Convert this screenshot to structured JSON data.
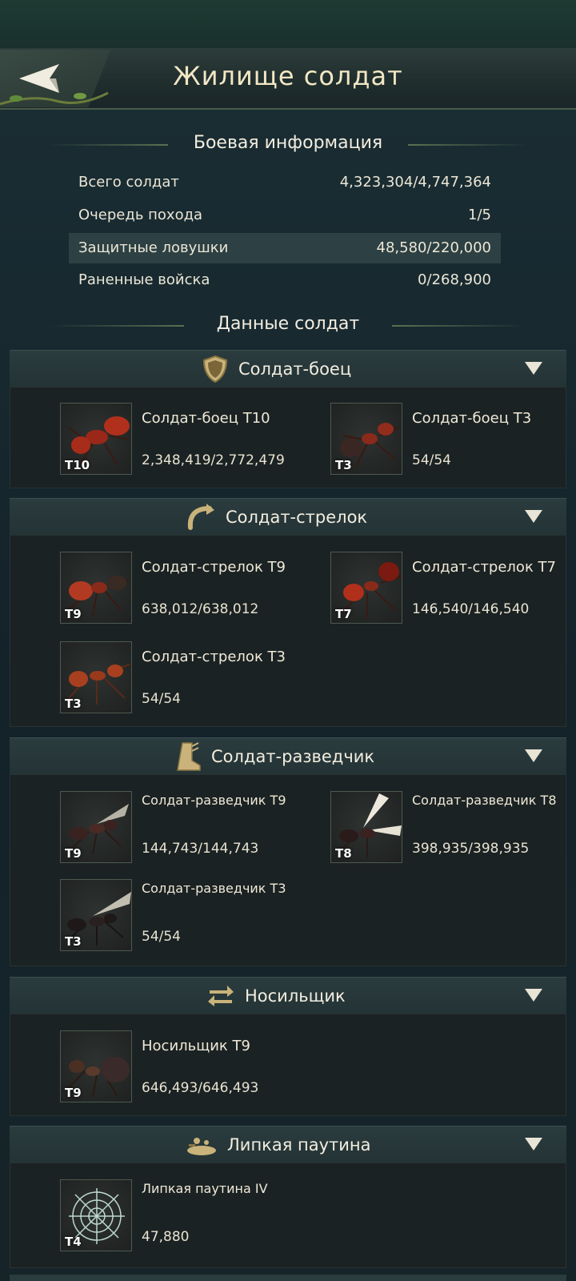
{
  "header": {
    "title": "Жилище солдат"
  },
  "battle_info": {
    "title": "Боевая информация",
    "rows": [
      {
        "label": "Всего солдат",
        "value": "4,323,304/4,747,364"
      },
      {
        "label": "Очередь похода",
        "value": "1/5"
      },
      {
        "label": "Защитные ловушки",
        "value": "48,580/220,000"
      },
      {
        "label": "Раненные войска",
        "value": "0/268,900"
      }
    ]
  },
  "soldier_data": {
    "title": "Данные солдат"
  },
  "categories": [
    {
      "title": "Солдат-боец",
      "icon": "shield-icon",
      "units": [
        {
          "name": "Солдат-боец T10",
          "count": "2,348,419/2,772,479",
          "tier": "T10"
        },
        {
          "name": "Солдат-боец T3",
          "count": "54/54",
          "tier": "T3"
        }
      ]
    },
    {
      "title": "Солдат-стрелок",
      "icon": "bow-icon",
      "units": [
        {
          "name": "Солдат-стрелок T9",
          "count": "638,012/638,012",
          "tier": "T9"
        },
        {
          "name": "Солдат-стрелок T7",
          "count": "146,540/146,540",
          "tier": "T7"
        },
        {
          "name": "Солдат-стрелок T3",
          "count": "54/54",
          "tier": "T3"
        }
      ]
    },
    {
      "title": "Солдат-разведчик",
      "icon": "boot-icon",
      "units": [
        {
          "name": "Солдат-разведчик T9",
          "count": "144,743/144,743",
          "tier": "T9"
        },
        {
          "name": "Солдат-разведчик T8",
          "count": "398,935/398,935",
          "tier": "T8"
        },
        {
          "name": "Солдат-разведчик T3",
          "count": "54/54",
          "tier": "T3"
        }
      ]
    },
    {
      "title": "Носильщик",
      "icon": "arrows-icon",
      "units": [
        {
          "name": "Носильщик T9",
          "count": "646,493/646,493",
          "tier": "T9"
        }
      ]
    },
    {
      "title": "Липкая паутина",
      "icon": "web-trap-icon",
      "units": [
        {
          "name": "Липкая паутина IV",
          "count": "47,880",
          "tier": "T4"
        }
      ]
    }
  ],
  "colors": {
    "accent_text": "#f2e7c4",
    "panel": "#243335",
    "background": "#16242a"
  }
}
